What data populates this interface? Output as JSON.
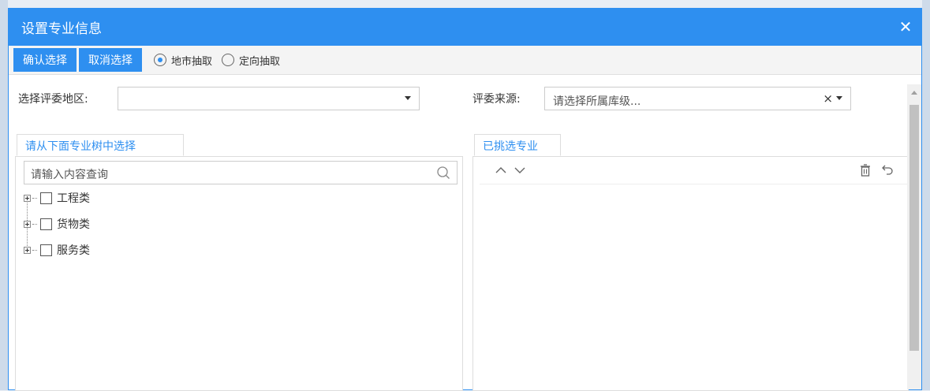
{
  "dialog": {
    "title": "设置专业信息",
    "close_icon": "close-icon"
  },
  "toolbar": {
    "confirm_label": "确认选择",
    "cancel_label": "取消选择",
    "radio_options": [
      {
        "label": "地市抽取",
        "selected": true
      },
      {
        "label": "定向抽取",
        "selected": false
      }
    ]
  },
  "filters": {
    "region_label": "选择评委地区:",
    "region_value": "",
    "source_label": "评委来源:",
    "source_placeholder": "请选择所属库级..."
  },
  "left_panel": {
    "tab_label": "请从下面专业树中选择",
    "search_placeholder": "请输入内容查询",
    "tree": [
      {
        "label": "工程类"
      },
      {
        "label": "货物类"
      },
      {
        "label": "服务类"
      }
    ]
  },
  "right_panel": {
    "tab_label": "已挑选专业",
    "icons": [
      "chevron-up-icon",
      "chevron-down-icon",
      "trash-icon",
      "undo-icon"
    ]
  },
  "colors": {
    "accent": "#2e8ff0"
  }
}
